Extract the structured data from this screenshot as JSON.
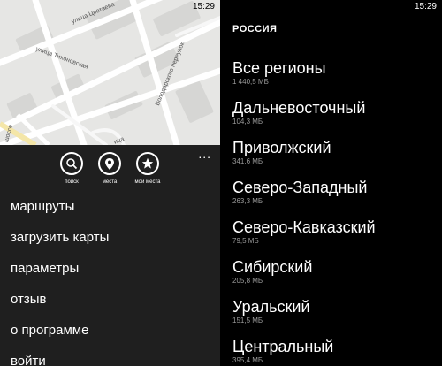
{
  "status": {
    "time": "15:29"
  },
  "left": {
    "map_labels": {
      "street_1": "улица Цветаева",
      "street_2": "улица Тихоновская",
      "street_3": "Володарского переулок",
      "street_4": "шоссе",
      "street_5": "ица"
    },
    "app_bar": {
      "more": "...",
      "buttons": [
        {
          "label": "поиск",
          "icon": "search-icon"
        },
        {
          "label": "места",
          "icon": "location-icon"
        },
        {
          "label": "мои места",
          "icon": "star-icon"
        }
      ]
    },
    "menu": [
      "маршруты",
      "загрузить карты",
      "параметры",
      "отзыв",
      "о программе",
      "войти"
    ]
  },
  "right": {
    "header": "РОССИЯ",
    "regions": [
      {
        "name": "Все регионы",
        "size": "1 440,5 МБ"
      },
      {
        "name": "Дальневосточный",
        "size": "104,3 МБ"
      },
      {
        "name": "Приволжский",
        "size": "341,6 МБ"
      },
      {
        "name": "Северо-Западный",
        "size": "263,3 МБ"
      },
      {
        "name": "Северо-Кавказский",
        "size": "79,5 МБ"
      },
      {
        "name": "Сибирский",
        "size": "205,8 МБ"
      },
      {
        "name": "Уральский",
        "size": "151,5 МБ"
      },
      {
        "name": "Центральный",
        "size": "395,4 МБ"
      }
    ]
  }
}
